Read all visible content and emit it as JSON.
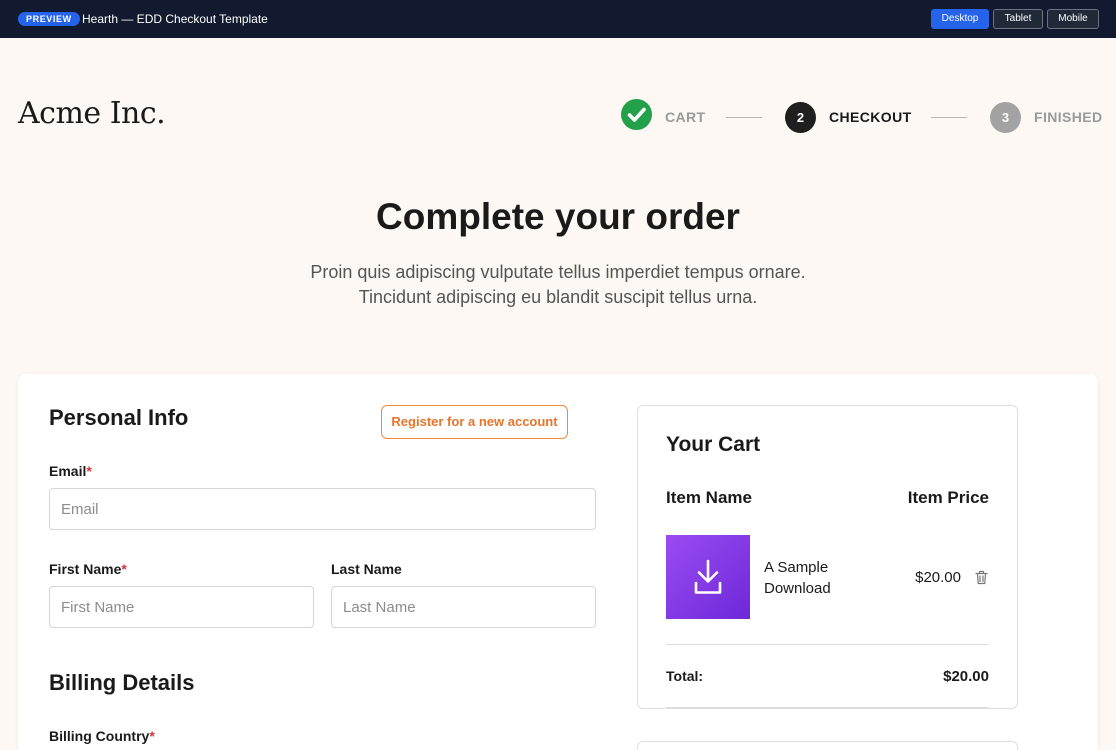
{
  "topbar": {
    "badge": "PREVIEW",
    "title": "Hearth — EDD Checkout Template",
    "devices": {
      "desktop": "Desktop",
      "tablet": "Tablet",
      "mobile": "Mobile"
    },
    "active_device": "Desktop",
    "accent_color": "#2563eb"
  },
  "brand": {
    "name": "Acme Inc."
  },
  "steps": [
    {
      "label": "CART",
      "state": "complete",
      "icon": "check-icon"
    },
    {
      "label": "CHECKOUT",
      "number": "2",
      "state": "current"
    },
    {
      "label": "FINISHED",
      "number": "3",
      "state": "upcoming"
    }
  ],
  "hero": {
    "title": "Complete your order",
    "subtitle_line1": "Proin quis adipiscing vulputate tellus imperdiet tempus ornare.",
    "subtitle_line2": "Tincidunt adipiscing eu blandit suscipit tellus urna."
  },
  "personal_info": {
    "heading": "Personal Info",
    "register_label": "Register for a new account",
    "email_label": "Email",
    "email_placeholder": "Email",
    "first_name_label": "First Name",
    "first_name_placeholder": "First Name",
    "last_name_label": "Last Name",
    "last_name_placeholder": "Last Name",
    "required_mark": "*"
  },
  "billing": {
    "heading": "Billing Details",
    "country_label": "Billing Country"
  },
  "cart": {
    "title": "Your Cart",
    "col_name": "Item Name",
    "col_price": "Item Price",
    "items": [
      {
        "name": "A Sample Download",
        "price": "$20.00",
        "thumb_icon": "download-icon",
        "remove_icon": "trash-icon"
      }
    ],
    "total_label": "Total:",
    "total_value": "$20.00"
  },
  "colors": {
    "page_bg": "#fdf8f3",
    "success": "#22a04a",
    "register_accent": "#f08a3c",
    "required": "#d6343a",
    "thumb_gradient": [
      "#9b4cf0",
      "#6d28d9"
    ]
  }
}
